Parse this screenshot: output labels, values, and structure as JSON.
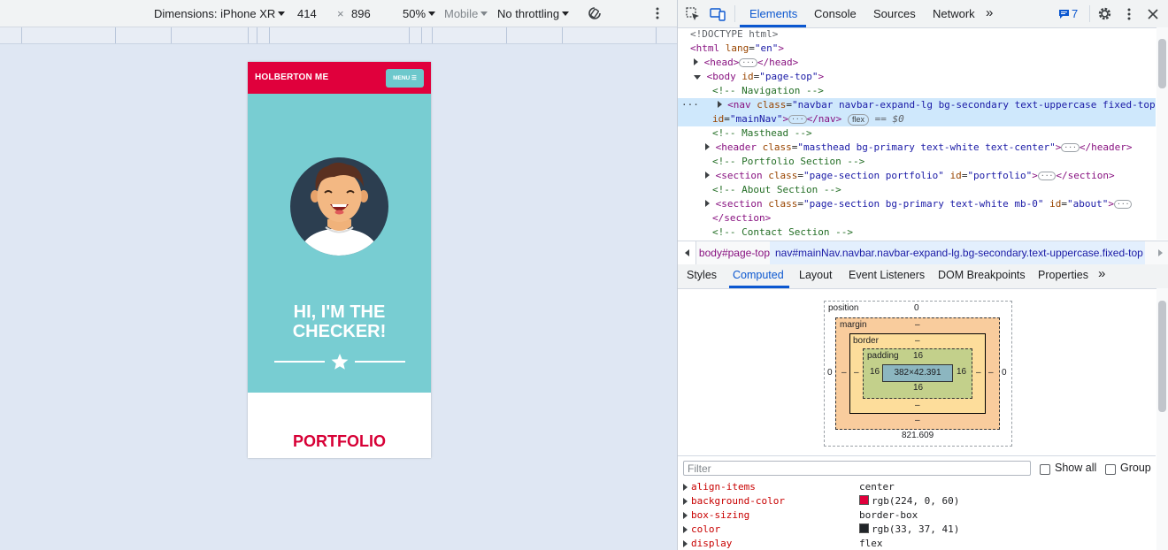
{
  "device_toolbar": {
    "dimensions_label": "Dimensions: iPhone XR",
    "width": "414",
    "times": "×",
    "height": "896",
    "zoom": "50%",
    "mode": "Mobile",
    "throttle": "No throttling"
  },
  "phone": {
    "brand": "HOLBERTON ME",
    "menu_label": "MENU ☰",
    "headline_1": "HI, I'M THE",
    "headline_2": "CHECKER!",
    "section_title": "PORTFOLIO",
    "colors": {
      "nav": "#e0003c",
      "masthead": "#78cdd2",
      "accent": "#d70036"
    }
  },
  "devtools": {
    "tabs": [
      "Elements",
      "Console",
      "Sources",
      "Network"
    ],
    "more_tabs": "»",
    "issues_count": "7",
    "dom_lines": {
      "doctype": "<!DOCTYPE html>",
      "html_open": "<html",
      "html_attr": "lang",
      "html_val": "\"en\"",
      "html_close": ">",
      "head": "<head>",
      "head_close": "</head>",
      "body_open": "<body",
      "body_attr": "id",
      "body_val": "\"page-top\"",
      "c_nav": "<!-- Navigation -->",
      "nav_open": "<nav",
      "nav_class_attr": "class",
      "nav_class_val": "\"navbar navbar-expand-lg bg-secondary text-uppercase fixed-top\"",
      "nav_id_attr": "id",
      "nav_id_val": "\"mainNav\"",
      "nav_close": "</nav>",
      "flex_badge": "flex",
      "eq": "== $0",
      "c_masthead": "<!-- Masthead -->",
      "header_open": "<header",
      "header_class_val": "\"masthead bg-primary text-white text-center\"",
      "header_close": "</header>",
      "c_portfolio": "<!-- Portfolio Section -->",
      "section_open": "<section",
      "portfolio_class_val": "\"page-section portfolio\"",
      "portfolio_id_val": "\"portfolio\"",
      "section_close": "</section>",
      "c_about": "<!-- About Section -->",
      "about_class_val": "\"page-section bg-primary text-white mb-0\"",
      "about_id_val": "\"about\"",
      "c_contact": "<!-- Contact Section -->"
    },
    "breadcrumb_1": "body#page-top",
    "breadcrumb_2": "nav#mainNav.navbar.navbar-expand-lg.bg-secondary.text-uppercase.fixed-top",
    "subtabs": [
      "Styles",
      "Computed",
      "Layout",
      "Event Listeners",
      "DOM Breakpoints",
      "Properties"
    ],
    "box_model": {
      "position_label": "position",
      "position_top": "0",
      "position_left": "0",
      "position_right": "0",
      "margin_label": "margin",
      "margin_dash": "–",
      "border_label": "border",
      "border_dash": "–",
      "padding_label": "padding",
      "padding_top": "16",
      "padding_left": "16",
      "padding_right": "16",
      "padding_bottom": "16",
      "content": "382×42.391",
      "bottom_value": "821.609"
    },
    "filter_placeholder": "Filter",
    "show_all": "Show all",
    "group": "Group",
    "properties": [
      {
        "name": "align-items",
        "value": "center"
      },
      {
        "name": "background-color",
        "value": "rgb(224, 0, 60)",
        "swatch": "#e0003c"
      },
      {
        "name": "box-sizing",
        "value": "border-box"
      },
      {
        "name": "color",
        "value": "rgb(33, 37, 41)",
        "swatch": "#212529"
      },
      {
        "name": "display",
        "value": "flex"
      }
    ]
  }
}
